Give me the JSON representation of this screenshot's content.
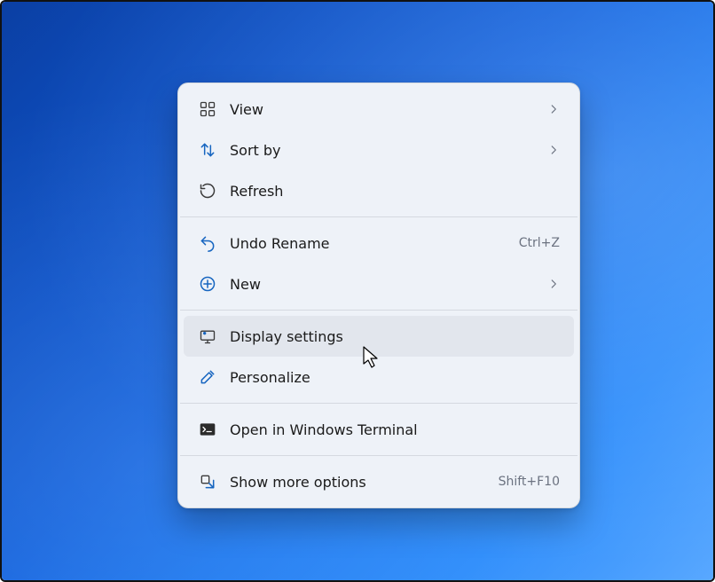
{
  "menu": {
    "hovered_id": "display-settings",
    "items": [
      {
        "id": "view",
        "label": "View",
        "icon": "grid",
        "submenu": true,
        "shortcut": ""
      },
      {
        "id": "sort-by",
        "label": "Sort by",
        "icon": "sort",
        "submenu": true,
        "shortcut": ""
      },
      {
        "id": "refresh",
        "label": "Refresh",
        "icon": "refresh",
        "submenu": false,
        "shortcut": ""
      },
      {
        "separator": true
      },
      {
        "id": "undo",
        "label": "Undo Rename",
        "icon": "undo",
        "submenu": false,
        "shortcut": "Ctrl+Z"
      },
      {
        "id": "new",
        "label": "New",
        "icon": "plus",
        "submenu": true,
        "shortcut": ""
      },
      {
        "separator": true
      },
      {
        "id": "display-settings",
        "label": "Display settings",
        "icon": "display",
        "submenu": false,
        "shortcut": ""
      },
      {
        "id": "personalize",
        "label": "Personalize",
        "icon": "brush",
        "submenu": false,
        "shortcut": ""
      },
      {
        "separator": true
      },
      {
        "id": "open-terminal",
        "label": "Open in Windows Terminal",
        "icon": "terminal",
        "submenu": false,
        "shortcut": ""
      },
      {
        "separator": true
      },
      {
        "id": "show-more",
        "label": "Show more options",
        "icon": "expand",
        "submenu": false,
        "shortcut": "Shift+F10"
      }
    ]
  }
}
